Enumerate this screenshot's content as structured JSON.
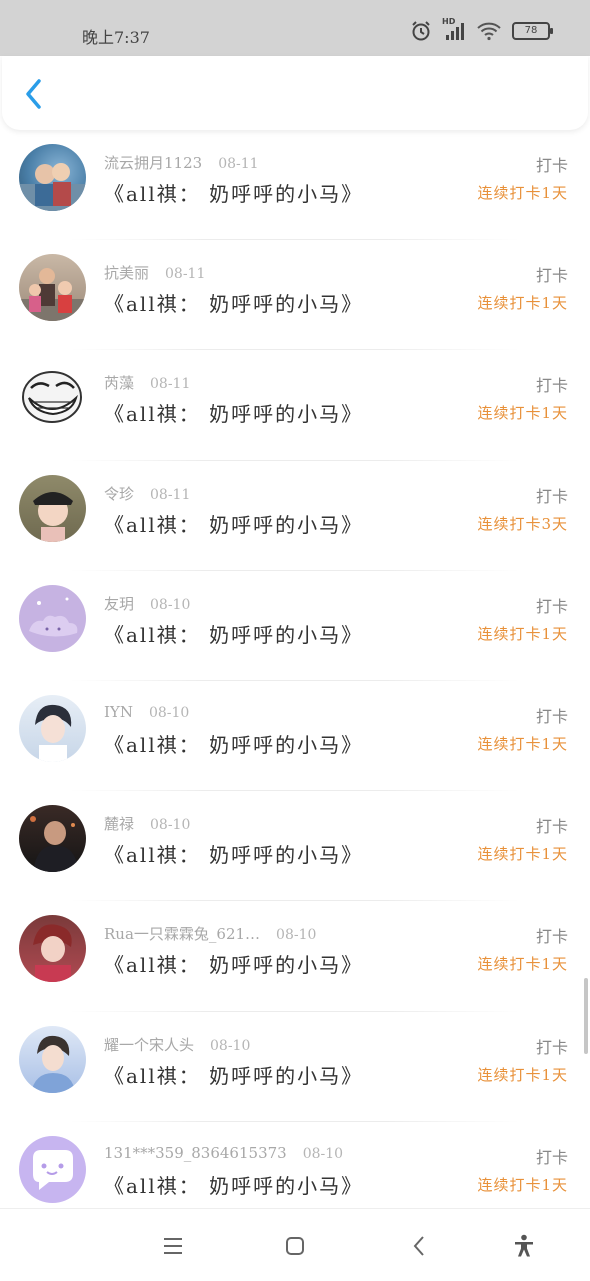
{
  "status_bar": {
    "time": "晚上7:37",
    "battery": "78",
    "network_label": "HD"
  },
  "header": {
    "back_icon": "chevron-left-icon"
  },
  "colors": {
    "accent": "#2a9de8",
    "streak": "#e8913a"
  },
  "items": [
    {
      "name": "流云拥月1123",
      "date": "08-11",
      "title": "《all祺： 奶呼呼的小马》",
      "action": "打卡",
      "streak": "连续打卡1天"
    },
    {
      "name": "抗美丽",
      "date": "08-11",
      "title": "《all祺： 奶呼呼的小马》",
      "action": "打卡",
      "streak": "连续打卡1天"
    },
    {
      "name": "芮藻",
      "date": "08-11",
      "title": "《all祺： 奶呼呼的小马》",
      "action": "打卡",
      "streak": "连续打卡1天"
    },
    {
      "name": "令珍",
      "date": "08-11",
      "title": "《all祺： 奶呼呼的小马》",
      "action": "打卡",
      "streak": "连续打卡3天"
    },
    {
      "name": "友玥",
      "date": "08-10",
      "title": "《all祺： 奶呼呼的小马》",
      "action": "打卡",
      "streak": "连续打卡1天"
    },
    {
      "name": "IYN",
      "date": "08-10",
      "title": "《all祺： 奶呼呼的小马》",
      "action": "打卡",
      "streak": "连续打卡1天"
    },
    {
      "name": "麓禄",
      "date": "08-10",
      "title": "《all祺： 奶呼呼的小马》",
      "action": "打卡",
      "streak": "连续打卡1天"
    },
    {
      "name": "Rua一只霖霖兔_621…",
      "date": "08-10",
      "title": "《all祺： 奶呼呼的小马》",
      "action": "打卡",
      "streak": "连续打卡1天"
    },
    {
      "name": "耀一个宋人头",
      "date": "08-10",
      "title": "《all祺： 奶呼呼的小马》",
      "action": "打卡",
      "streak": "连续打卡1天"
    },
    {
      "name": "131***359_8364615373",
      "date": "08-10",
      "title": "《all祺： 奶呼呼的小马》",
      "action": "打卡",
      "streak": "连续打卡1天"
    }
  ],
  "nav_bar": {
    "menu_icon": "menu-icon",
    "home_icon": "home-icon",
    "back_icon": "back-icon",
    "accessibility_icon": "accessibility-icon"
  }
}
